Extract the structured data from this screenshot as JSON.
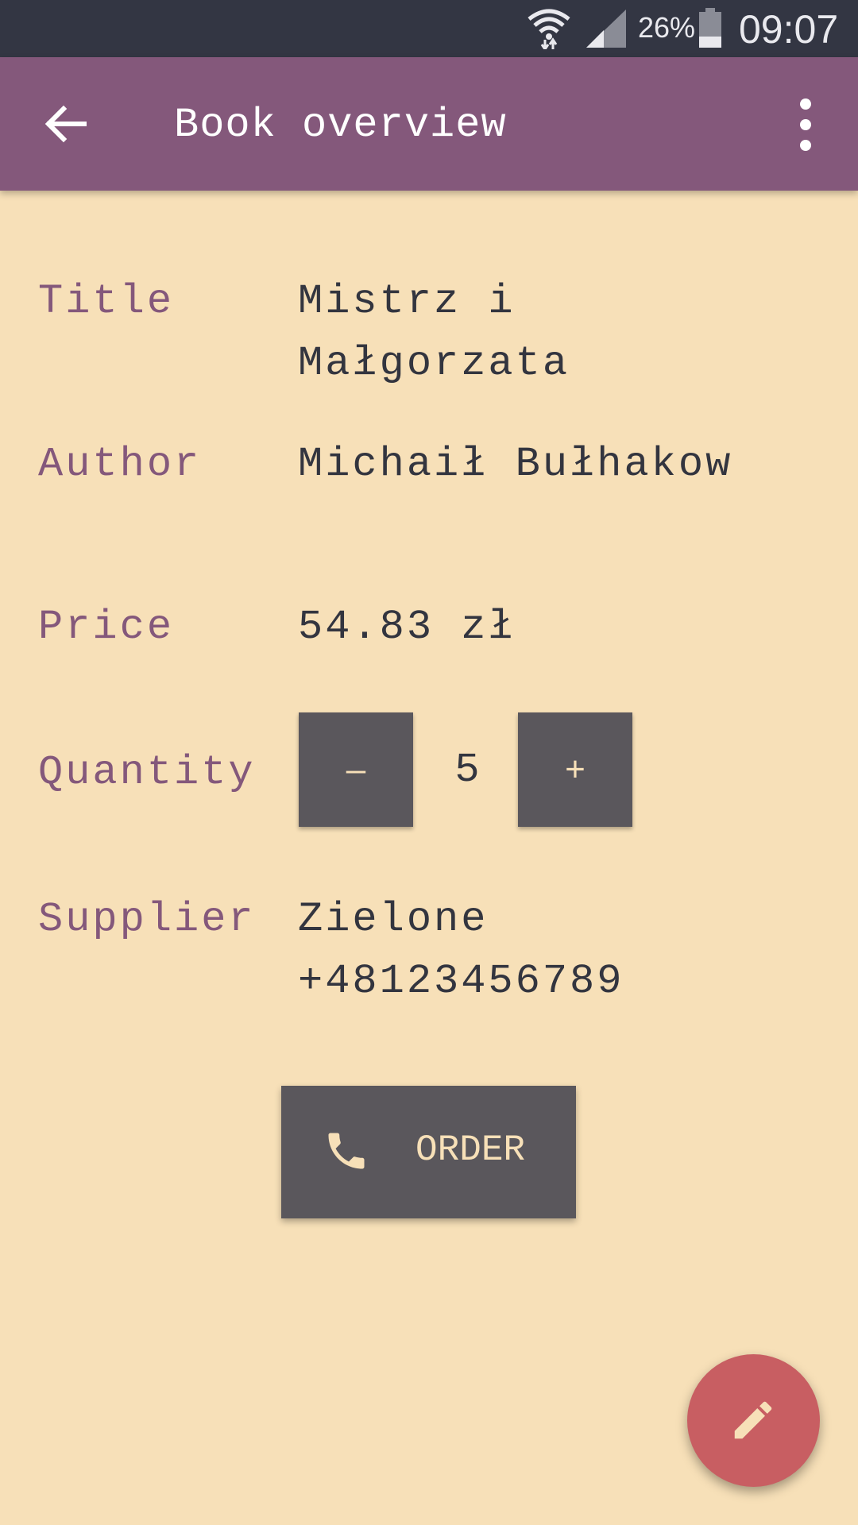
{
  "status_bar": {
    "battery_percent": "26%",
    "time": "09:07",
    "icons": [
      "wifi-icon",
      "signal-icon",
      "battery-icon"
    ]
  },
  "app_bar": {
    "title": "Book overview",
    "icons": [
      "back-arrow-icon",
      "more-vert-icon"
    ],
    "color": "#84587b"
  },
  "details": {
    "title_label": "Title",
    "title_line1": "Mistrz i",
    "title_line2": "Małgorzata",
    "author_label": "Author",
    "author_value": "Michaił Bułhakow",
    "price_label": "Price",
    "price_value": "54.83 zł",
    "quantity_label": "Quantity",
    "quantity_decrease": "–",
    "quantity_value": "5",
    "quantity_increase": "+",
    "supplier_label": "Supplier",
    "supplier_name": "Zielone",
    "supplier_phone": "+48123456789"
  },
  "order_button": {
    "label": "ORDER",
    "icon": "phone-icon"
  },
  "fab": {
    "icon": "pencil-icon",
    "color": "#c85e62"
  },
  "colors": {
    "background": "#f7e0b8",
    "label": "#84587b",
    "value": "#33353f",
    "button": "#5a575c"
  }
}
